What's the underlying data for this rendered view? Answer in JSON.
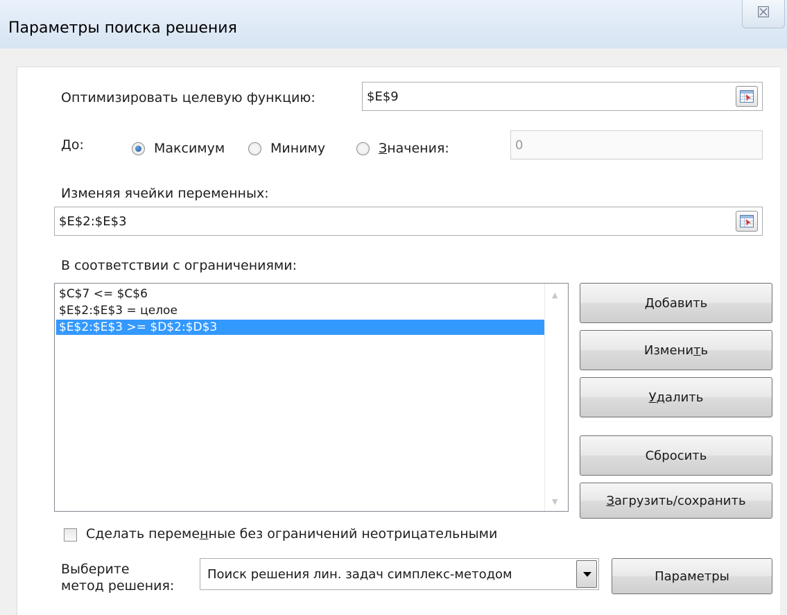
{
  "window": {
    "title": "Параметры поиска решения",
    "close_glyph": "☒"
  },
  "objective": {
    "label": "Оптимизировать целевую функцию:",
    "value": "$E$9"
  },
  "target": {
    "label": "До:",
    "options": [
      {
        "label": "Максимум",
        "selected": true
      },
      {
        "label": "Миниму",
        "selected": false
      },
      {
        "label": "Значения:",
        "selected": false
      }
    ],
    "value_field": "0"
  },
  "variables": {
    "label": "Изменяя ячейки переменных:",
    "value": "$E$2:$E$3"
  },
  "constraints": {
    "label": "В соответствии с ограничениями:",
    "items": [
      {
        "text": "$C$7 <= $C$6",
        "selected": false
      },
      {
        "text": "$E$2:$E$3 = целое",
        "selected": false
      },
      {
        "text": "$E$2:$E$3 >= $D$2:$D$3",
        "selected": true
      }
    ]
  },
  "buttons": {
    "add": "Добавить",
    "change": "Изменить",
    "delete": "Удалить",
    "reset": "Сбросить",
    "load_save": "Загрузить/сохранить",
    "options": "Параметры"
  },
  "nonneg": {
    "label": "Сделать переменные без ограничений неотрицательными",
    "checked": false
  },
  "method": {
    "label_line1": "Выберите",
    "label_line2": "метод решения:",
    "value": "Поиск решения лин. задач симплекс-методом"
  },
  "icons": {
    "ref_button": "range-select-icon",
    "close": "close-icon"
  },
  "colors": {
    "selection": "#3399ff",
    "title_bg": "#dfe9f5"
  }
}
